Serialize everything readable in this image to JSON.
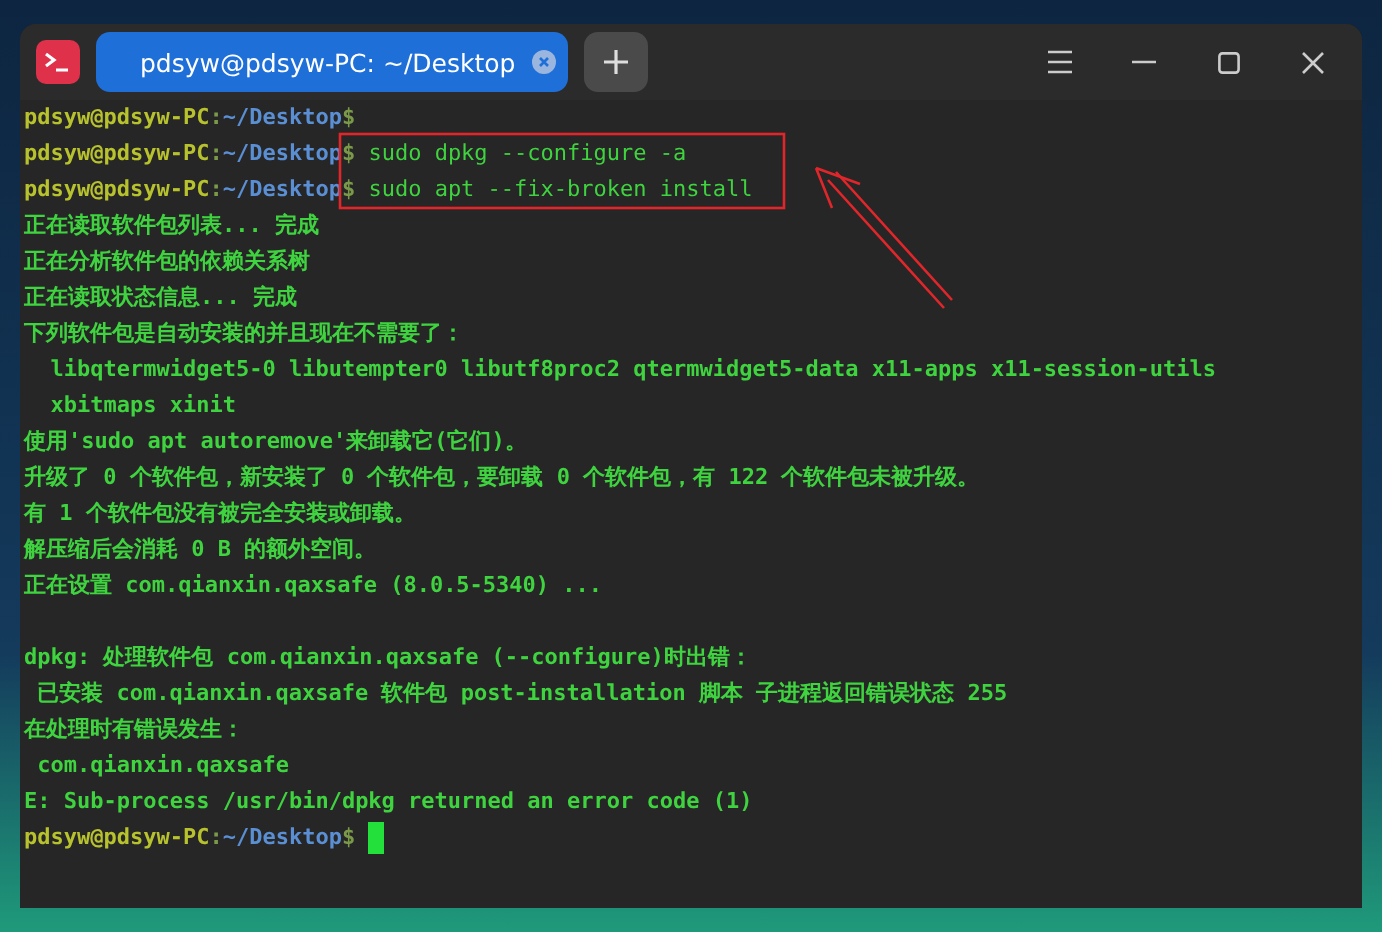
{
  "window": {
    "tabs": [
      {
        "label": "pdsyw@pdsyw-PC: ~/Desktop",
        "selected": true
      }
    ]
  },
  "terminal": {
    "lines": [
      {
        "kind": "prompt",
        "user": "pdsyw@pdsyw-PC",
        "separator": ":",
        "path": "~/Desktop",
        "symbol": "$",
        "cursor": false
      },
      {
        "kind": "prompt",
        "user": "pdsyw@pdsyw-PC",
        "separator": ":",
        "path": "~/Desktop",
        "symbol": "$",
        "command": "sudo dpkg --configure -a",
        "cursor": false
      },
      {
        "kind": "prompt",
        "user": "pdsyw@pdsyw-PC",
        "separator": ":",
        "path": "~/Desktop",
        "symbol": "$",
        "command": "sudo apt --fix-broken install",
        "cursor": false
      },
      {
        "kind": "output",
        "text": "正在读取软件包列表... 完成"
      },
      {
        "kind": "output",
        "text": "正在分析软件包的依赖关系树"
      },
      {
        "kind": "output",
        "text": "正在读取状态信息... 完成"
      },
      {
        "kind": "output",
        "text": "下列软件包是自动安装的并且现在不需要了："
      },
      {
        "kind": "output",
        "text": "  libqtermwidget5-0 libutempter0 libutf8proc2 qtermwidget5-data x11-apps x11-session-utils"
      },
      {
        "kind": "output",
        "text": "  xbitmaps xinit"
      },
      {
        "kind": "output",
        "text": "使用'sudo apt autoremove'来卸载它(它们)。"
      },
      {
        "kind": "output",
        "text": "升级了 0 个软件包，新安装了 0 个软件包，要卸载 0 个软件包，有 122 个软件包未被升级。"
      },
      {
        "kind": "output",
        "text": "有 1 个软件包没有被完全安装或卸载。"
      },
      {
        "kind": "output",
        "text": "解压缩后会消耗 0 B 的额外空间。"
      },
      {
        "kind": "output",
        "text": "正在设置 com.qianxin.qaxsafe (8.0.5-5340) ..."
      },
      {
        "kind": "blank"
      },
      {
        "kind": "output",
        "text": "dpkg: 处理软件包 com.qianxin.qaxsafe (--configure)时出错："
      },
      {
        "kind": "output",
        "text": " 已安装 com.qianxin.qaxsafe 软件包 post-installation 脚本 子进程返回错误状态 255"
      },
      {
        "kind": "output",
        "text": "在处理时有错误发生："
      },
      {
        "kind": "output",
        "text": " com.qianxin.qaxsafe"
      },
      {
        "kind": "output",
        "text": "E: Sub-process /usr/bin/dpkg returned an error code (1)"
      },
      {
        "kind": "prompt",
        "user": "pdsyw@pdsyw-PC",
        "separator": ":",
        "path": "~/Desktop",
        "symbol": "$",
        "cursor": true
      }
    ]
  }
}
